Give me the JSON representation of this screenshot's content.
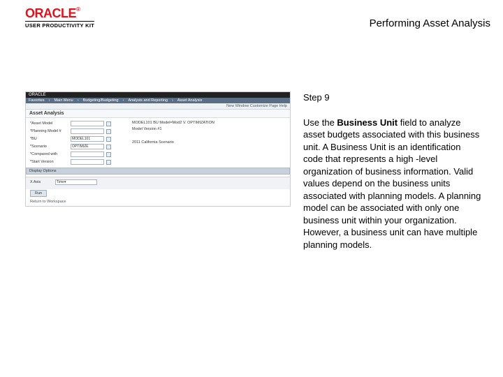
{
  "header": {
    "logo_text": "ORACLE",
    "logo_tm": "®",
    "subtitle": "USER PRODUCTIVITY KIT",
    "page_title": "Performing Asset Analysis"
  },
  "screenshot": {
    "brand": "ORACLE",
    "nav": [
      "Favorites",
      "Main Menu",
      "Budgeting/Budgeting",
      "Analysis and Reporting",
      "Asset Analysis"
    ],
    "toolbar": "New Window   Customize Page   Help",
    "section_title": "Asset Analysis",
    "fields": {
      "asset_model_label": "*Asset Model",
      "asset_model_value": "",
      "planning_model_label": "*Planning Model #",
      "planning_model_value": "",
      "bu_label": "*BU",
      "bu_value": "MODEL101",
      "scenario_label": "*Scenario",
      "scenario_value": "OPTIMIZE",
      "compare_label": "*Compared with",
      "start_label": "*Start Version",
      "desc1": "MODEL101 BU Model=Mod2 V. OPTIMIZATION",
      "desc2": "Model Version #1",
      "desc3": "2011 California Scenario"
    },
    "section2": "Display Options",
    "axis_label": "X Axis",
    "axis_value": "Time",
    "run_btn": "Run",
    "links": "Return to   Workspace"
  },
  "instruction": {
    "step": "Step 9",
    "text_before": "Use the ",
    "bold": "Business Unit",
    "text_after": " field to analyze asset budgets associated with this business unit. A Business Unit is an identification code that represents a high -level organization of business information. Valid values depend on the business units associated with planning models. A planning model can be associated with only one business unit within your organization. However, a business unit can have multiple planning models."
  }
}
